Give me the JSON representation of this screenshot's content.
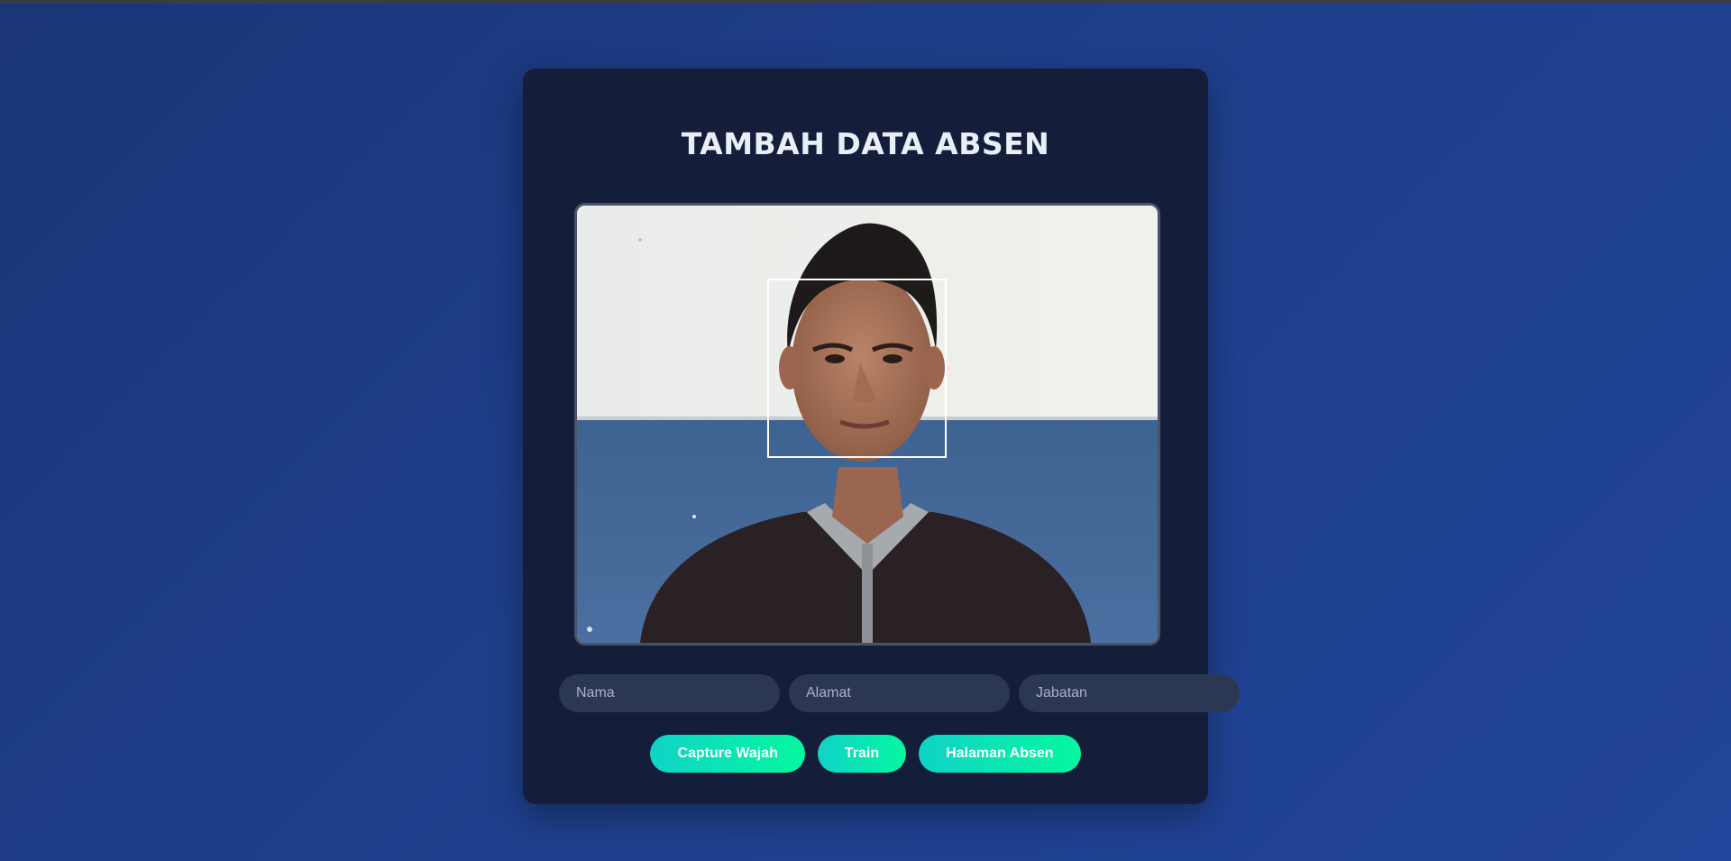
{
  "page": {
    "title": "TAMBAH DATA ABSEN"
  },
  "camera": {
    "feed_icon": "webcam-face-capture-feed",
    "face_detection_box": "face-detection-box"
  },
  "form": {
    "nama_placeholder": "Nama",
    "alamat_placeholder": "Alamat",
    "jabatan_placeholder": "Jabatan"
  },
  "actions": {
    "capture_label": "Capture Wajah",
    "train_label": "Train",
    "absen_page_label": "Halaman Absen"
  },
  "colors": {
    "background": "#1e3f8a",
    "card": "#141e3a",
    "button_gradient_start": "#0fd3c6",
    "button_gradient_end": "#05f7a0",
    "input_background": "#2c3753"
  }
}
